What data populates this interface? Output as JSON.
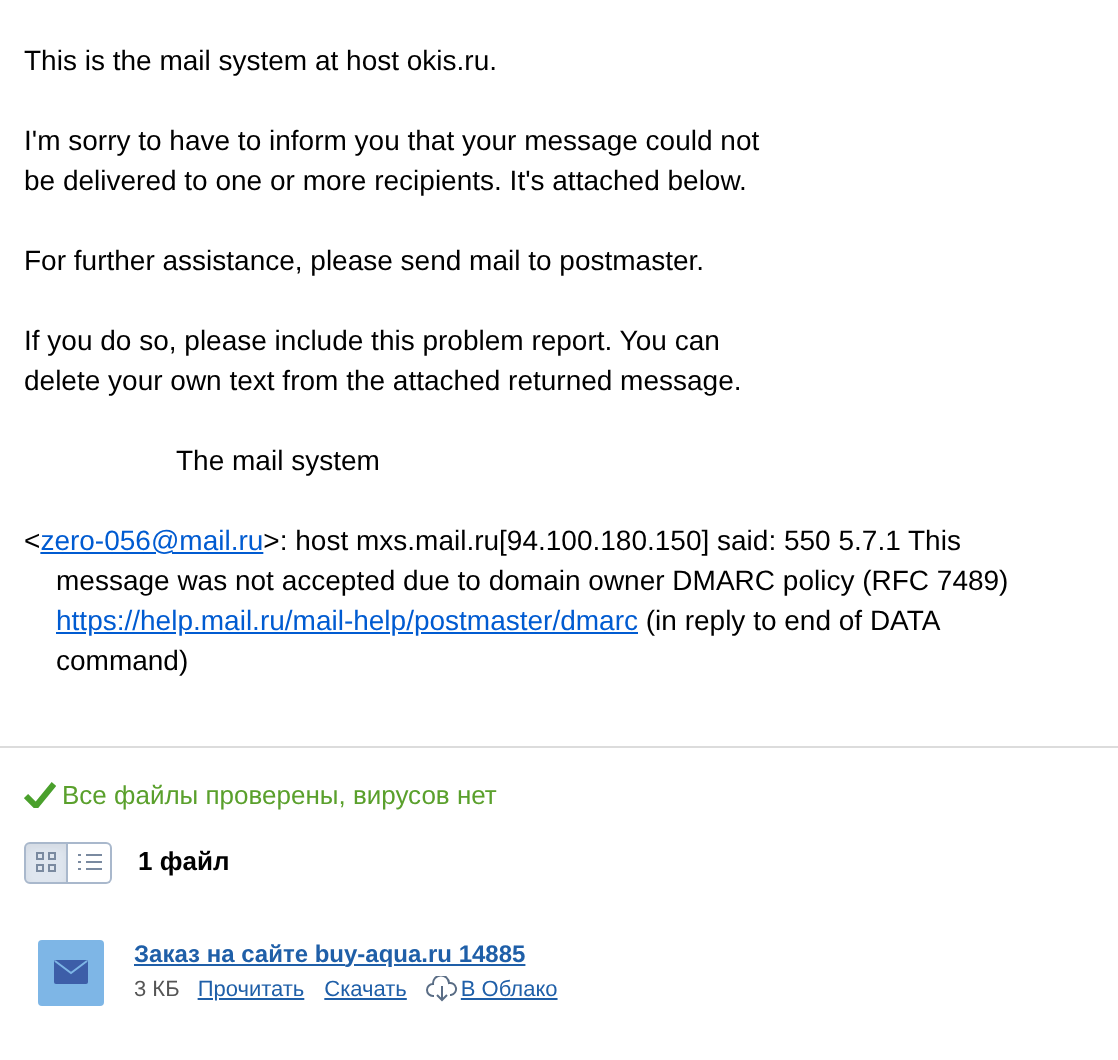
{
  "message": {
    "paragraphs": [
      "This is the mail system at host okis.ru.",
      "I'm sorry to have to inform you that your message could not\nbe delivered to one or more recipients. It's attached below.",
      "For further assistance, please send mail to postmaster.",
      "If you do so, please include this problem report. You can\ndelete your own text from the attached returned message."
    ],
    "signature": "The mail system",
    "report": {
      "open": "<",
      "email": "zero-056@mail.ru",
      "middle": ">: host mxs.mail.ru[94.100.180.150] said: 550 5.7.1 This\nmessage was not accepted due to domain owner DMARC policy (RFC 7489)\n",
      "url": "https://help.mail.ru/mail-help/postmaster/dmarc",
      "tail": " (in reply to end of DATA\ncommand)"
    }
  },
  "attachments": {
    "scan_status": "Все файлы проверены, вирусов нет",
    "views": [
      {
        "kind": "grid",
        "selected": true
      },
      {
        "kind": "list",
        "selected": false
      }
    ],
    "count": "1 файл",
    "files": [
      {
        "name": "Заказ на сайте buy-aqua.ru 14885",
        "size": "3 КБ",
        "actions": [
          {
            "kind": "read",
            "label": "Прочитать"
          },
          {
            "kind": "download",
            "label": "Скачать"
          },
          {
            "kind": "cloud",
            "label": "В Облако"
          }
        ]
      }
    ]
  }
}
